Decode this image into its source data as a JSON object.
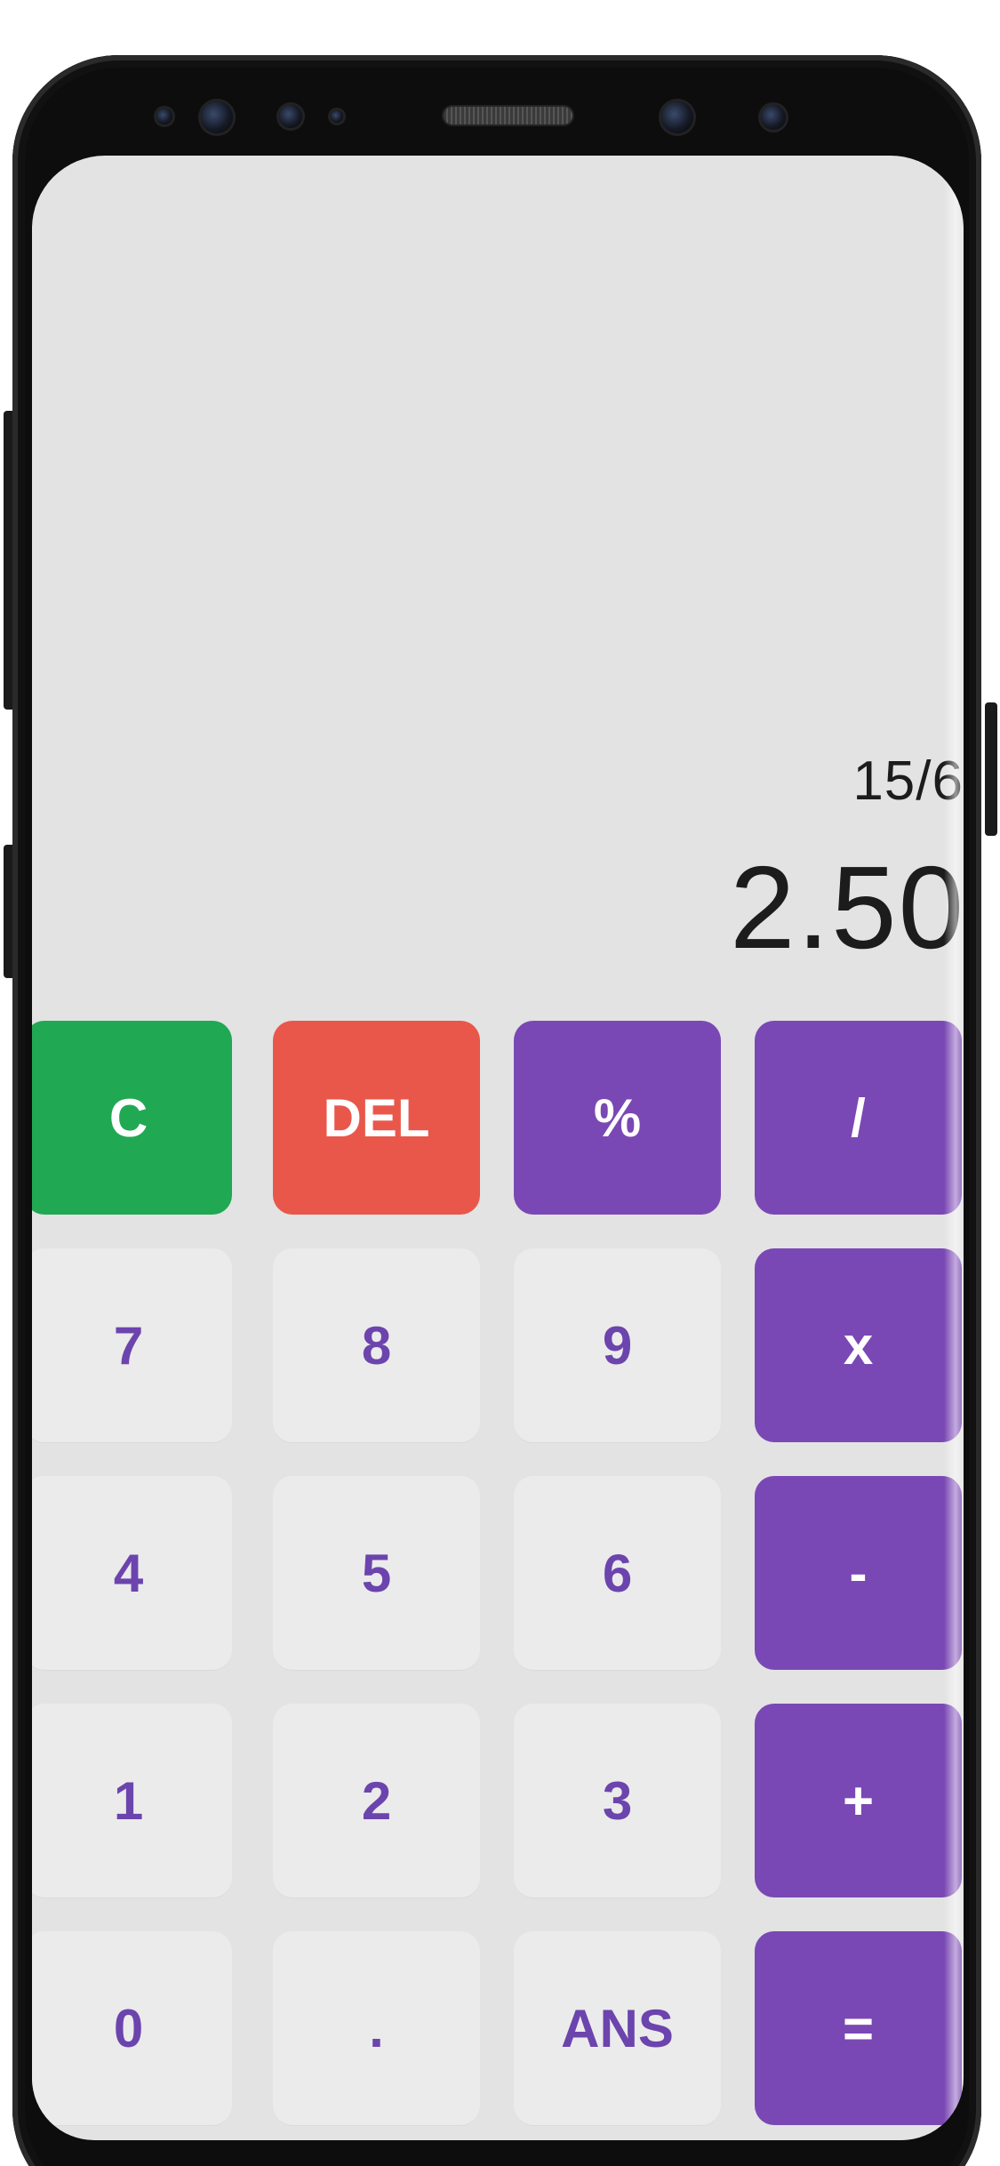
{
  "display": {
    "expression": "15/6",
    "result": "2.50"
  },
  "keys": {
    "clear": "C",
    "delete": "DEL",
    "percent": "%",
    "divide": "/",
    "seven": "7",
    "eight": "8",
    "nine": "9",
    "multiply": "x",
    "four": "4",
    "five": "5",
    "six": "6",
    "subtract": "-",
    "one": "1",
    "two": "2",
    "three": "3",
    "add": "+",
    "zero": "0",
    "decimal": ".",
    "answer": "ANS",
    "equals": "="
  },
  "colors": {
    "screen_background": "#e3e3e3",
    "number_key_background": "#ebebeb",
    "number_key_text": "#6c44ad",
    "operator_key": "#7a48b5",
    "clear_key": "#21a853",
    "delete_key": "#e9574b"
  }
}
